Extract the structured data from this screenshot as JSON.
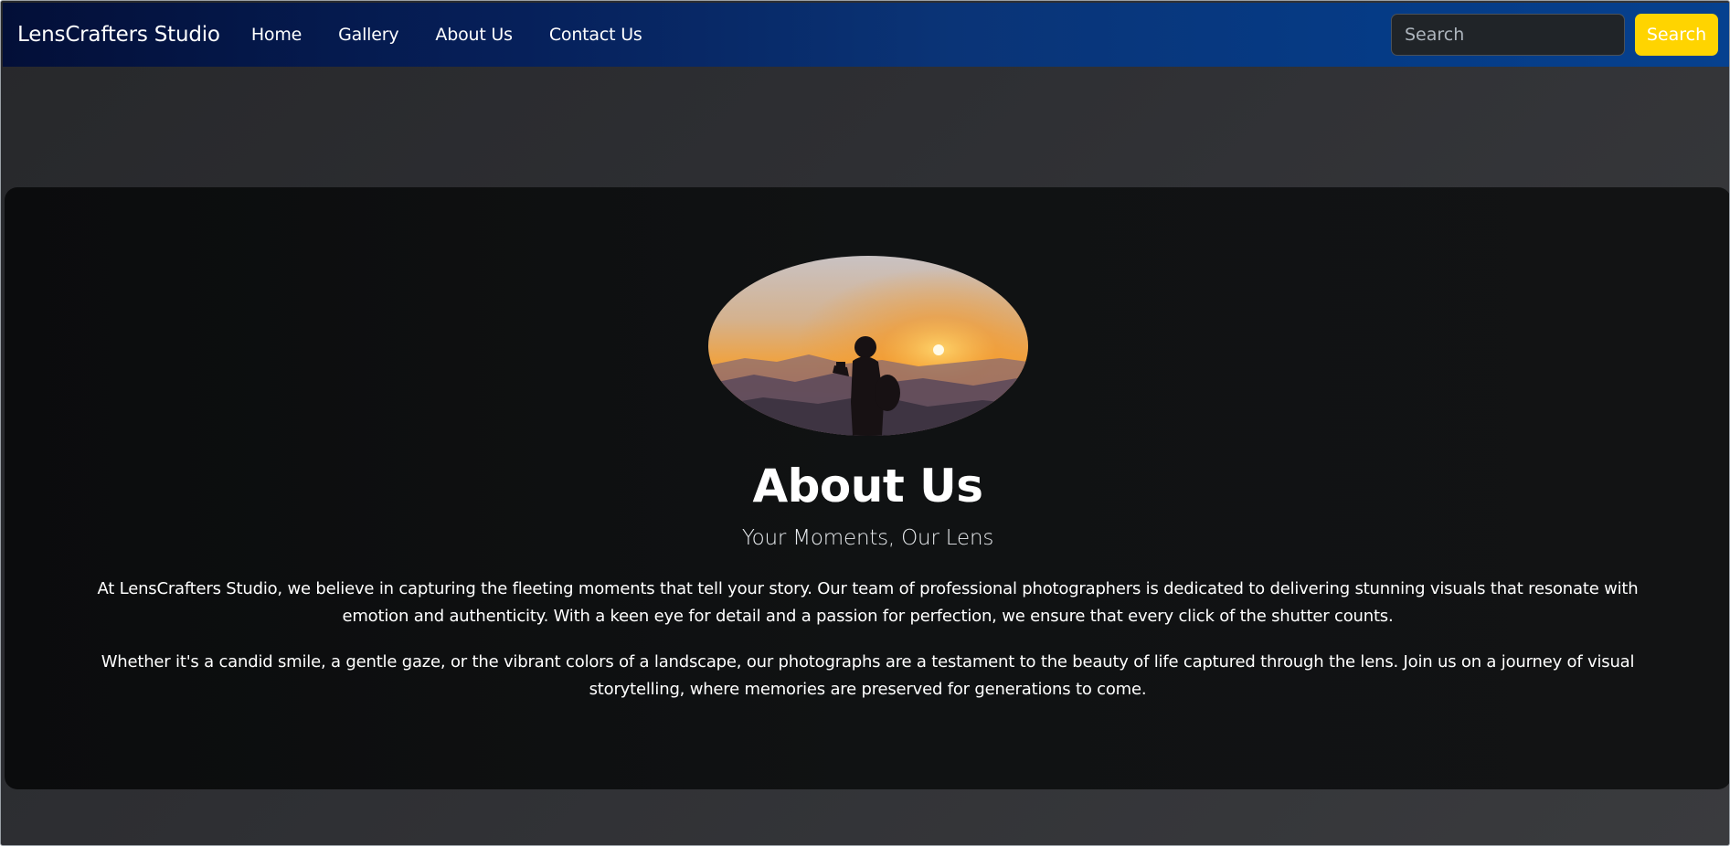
{
  "navbar": {
    "brand": "LensCrafters Studio",
    "links": [
      {
        "label": "Home"
      },
      {
        "label": "Gallery"
      },
      {
        "label": "About Us"
      },
      {
        "label": "Contact Us"
      }
    ],
    "search": {
      "placeholder": "Search",
      "value": "",
      "button_label": "Search"
    }
  },
  "about": {
    "image_icon": "photographer-sunset-image",
    "title": "About Us",
    "subtitle": "Your Moments, Our Lens",
    "paragraphs": [
      "At LensCrafters Studio, we believe in capturing the fleeting moments that tell your story. Our team of professional photographers is dedicated to delivering stunning visuals that resonate with emotion and authenticity. With a keen eye for detail and a passion for perfection, we ensure that every click of the shutter counts.",
      "Whether it's a candid smile, a gentle gaze, or the vibrant colors of a landscape, our photographs are a testament to the beauty of life captured through the lens. Join us on a journey of visual storytelling, where memories are preserved for generations to come."
    ]
  },
  "colors": {
    "navbar_start": "#030f38",
    "navbar_end": "#06418f",
    "search_button": "#ffd400",
    "card_background": "#0f1112",
    "page_background": "#2e2f33"
  }
}
